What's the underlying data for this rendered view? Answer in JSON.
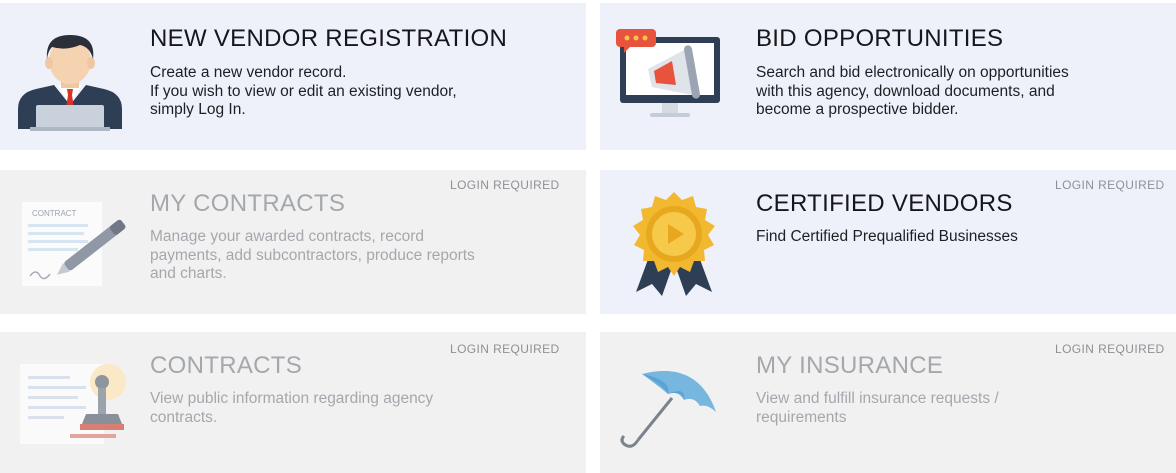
{
  "cards": [
    {
      "title": "NEW VENDOR REGISTRATION",
      "lines": [
        "Create a new vendor record.",
        "If you wish to view or edit an existing vendor,",
        "simply Log In."
      ],
      "icon": "vendor-person-icon",
      "badge": ""
    },
    {
      "title": "BID OPPORTUNITIES",
      "lines": [
        "Search and bid electronically on opportunities",
        "with this agency, download documents, and",
        "become a prospective bidder."
      ],
      "icon": "megaphone-monitor-icon",
      "badge": ""
    },
    {
      "title": "MY CONTRACTS",
      "lines": [
        "Manage your awarded contracts, record",
        "payments, add subcontractors, produce reports",
        "and charts."
      ],
      "icon": "contract-pen-icon",
      "icon_text": "CONTRACT",
      "badge": "LOGIN REQUIRED"
    },
    {
      "title": "CERTIFIED VENDORS",
      "lines": [
        "Find Certified Prequalified Businesses"
      ],
      "icon": "certified-badge-icon",
      "badge": "LOGIN REQUIRED"
    },
    {
      "title": "CONTRACTS",
      "lines": [
        "View public information regarding agency",
        "contracts."
      ],
      "icon": "document-stamp-icon",
      "badge": "LOGIN REQUIRED"
    },
    {
      "title": "MY INSURANCE",
      "lines": [
        "View and fulfill insurance requests /",
        "requirements"
      ],
      "icon": "umbrella-icon",
      "badge": "LOGIN REQUIRED"
    }
  ],
  "colors": {
    "active_bg": "#eef1fa",
    "disabled_bg": "#f1f1f1",
    "badge_gold": "#f2b830",
    "navy": "#2e3f55"
  }
}
